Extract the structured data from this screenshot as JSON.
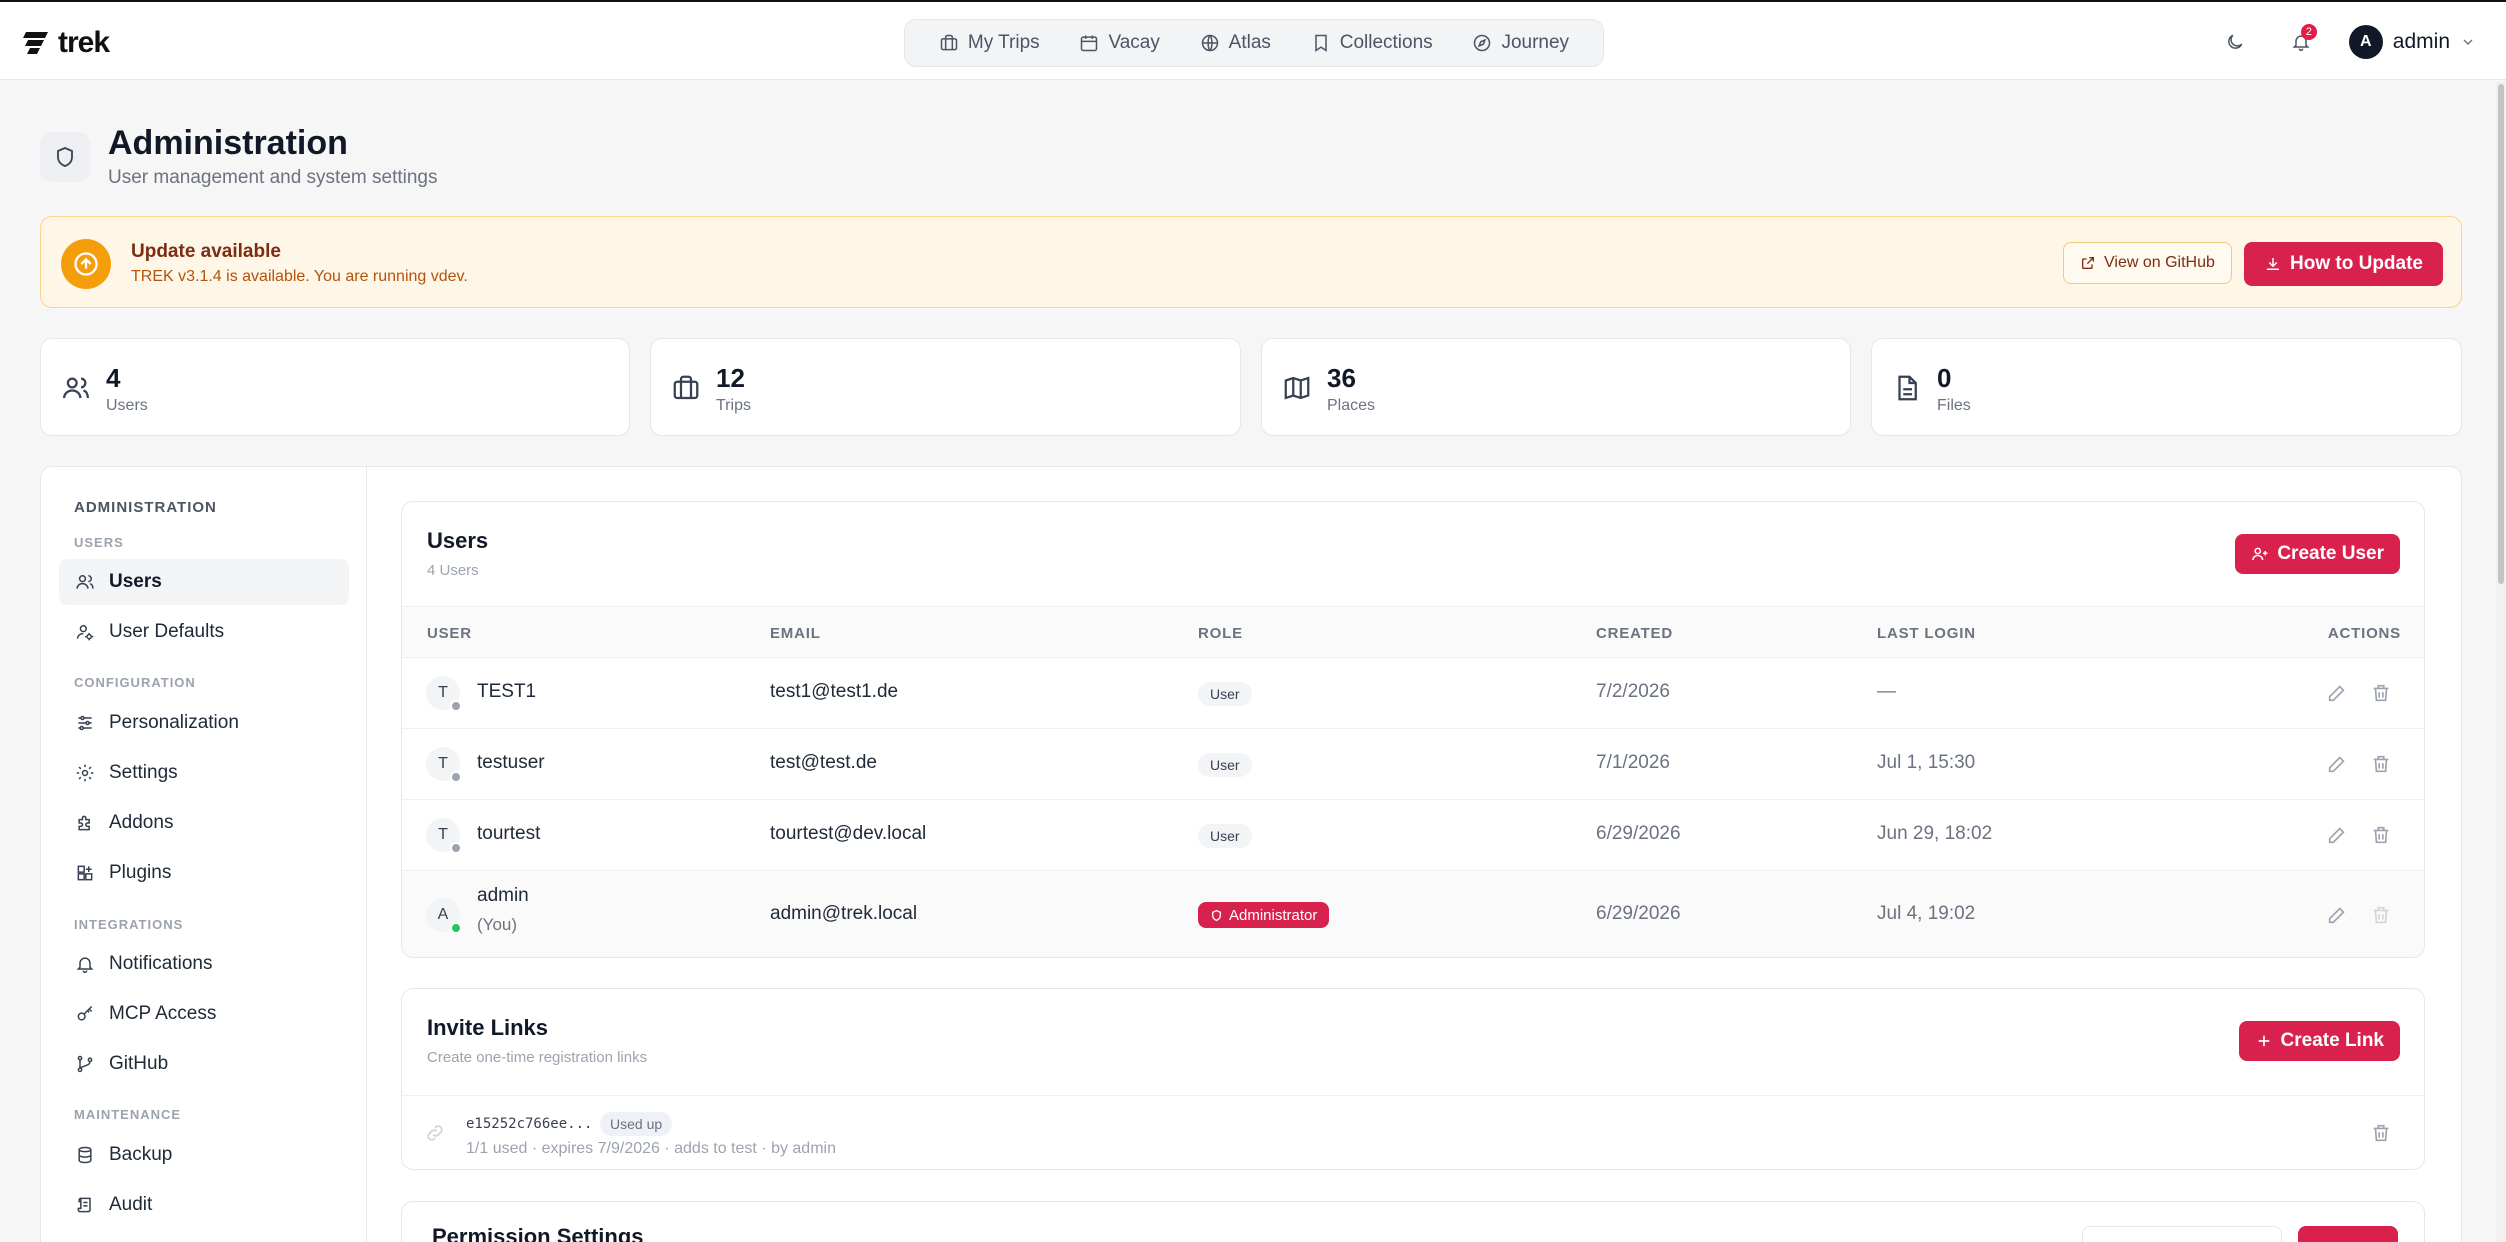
{
  "app": {
    "name": "trek"
  },
  "nav": {
    "items": [
      {
        "label": "My Trips",
        "icon": "briefcase-icon"
      },
      {
        "label": "Vacay",
        "icon": "calendar-icon"
      },
      {
        "label": "Atlas",
        "icon": "globe-icon"
      },
      {
        "label": "Collections",
        "icon": "bookmark-icon"
      },
      {
        "label": "Journey",
        "icon": "compass-icon"
      }
    ]
  },
  "header": {
    "notification_count": "2",
    "user_initial": "A",
    "user_name": "admin"
  },
  "page": {
    "title": "Administration",
    "subtitle": "User management and system settings"
  },
  "update": {
    "title": "Update available",
    "text": "TREK v3.1.4 is available. You are running vdev.",
    "github_label": "View on GitHub",
    "howto_label": "How to Update"
  },
  "stats": [
    {
      "value": "4",
      "label": "Users",
      "icon": "users-icon"
    },
    {
      "value": "12",
      "label": "Trips",
      "icon": "briefcase-icon"
    },
    {
      "value": "36",
      "label": "Places",
      "icon": "map-icon"
    },
    {
      "value": "0",
      "label": "Files",
      "icon": "file-icon"
    }
  ],
  "sidebar": {
    "heading": "ADMINISTRATION",
    "groups": {
      "users": "USERS",
      "configuration": "CONFIGURATION",
      "integrations": "INTEGRATIONS",
      "maintenance": "MAINTENANCE"
    },
    "items": {
      "users": "Users",
      "user_defaults": "User Defaults",
      "personalization": "Personalization",
      "settings": "Settings",
      "addons": "Addons",
      "plugins": "Plugins",
      "notifications": "Notifications",
      "mcp_access": "MCP Access",
      "github": "GitHub",
      "backup": "Backup",
      "audit": "Audit"
    }
  },
  "users_panel": {
    "title": "Users",
    "count_label": "4 Users",
    "create_label": "Create User",
    "columns": {
      "user": "USER",
      "email": "EMAIL",
      "role": "ROLE",
      "created": "CREATED",
      "last_login": "LAST LOGIN",
      "actions": "ACTIONS"
    },
    "rows": [
      {
        "initial": "T",
        "name": "TEST1",
        "email": "test1@test1.de",
        "role": "User",
        "created": "7/2/2026",
        "last_login": "—",
        "online": false
      },
      {
        "initial": "T",
        "name": "testuser",
        "email": "test@test.de",
        "role": "User",
        "created": "7/1/2026",
        "last_login": "Jul 1, 15:30",
        "online": false
      },
      {
        "initial": "T",
        "name": "tourtest",
        "email": "tourtest@dev.local",
        "role": "User",
        "created": "6/29/2026",
        "last_login": "Jun 29, 18:02",
        "online": false
      },
      {
        "initial": "A",
        "name": "admin",
        "you": "(You)",
        "email": "admin@trek.local",
        "role": "Administrator",
        "created": "6/29/2026",
        "last_login": "Jul 4, 19:02",
        "online": true
      }
    ]
  },
  "invite_panel": {
    "title": "Invite Links",
    "subtitle": "Create one-time registration links",
    "create_label": "Create Link",
    "links": [
      {
        "code": "e15252c766ee...",
        "status": "Used up",
        "meta": "1/1 used · expires 7/9/2026 · adds to test · by admin"
      }
    ]
  },
  "permission_panel": {
    "title": "Permission Settings"
  }
}
